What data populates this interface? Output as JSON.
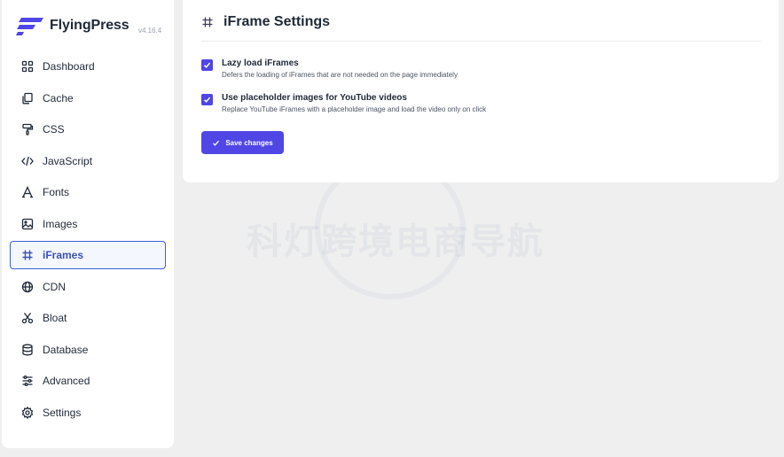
{
  "brand": {
    "name": "FlyingPress",
    "version": "v4.16.4"
  },
  "sidebar": {
    "items": [
      {
        "label": "Dashboard",
        "icon": "dashboard-icon"
      },
      {
        "label": "Cache",
        "icon": "copy-icon"
      },
      {
        "label": "CSS",
        "icon": "paint-roller-icon"
      },
      {
        "label": "JavaScript",
        "icon": "code-icon"
      },
      {
        "label": "Fonts",
        "icon": "font-icon"
      },
      {
        "label": "Images",
        "icon": "image-icon"
      },
      {
        "label": "iFrames",
        "icon": "hash-icon",
        "active": true
      },
      {
        "label": "CDN",
        "icon": "globe-icon"
      },
      {
        "label": "Bloat",
        "icon": "scissors-icon"
      },
      {
        "label": "Database",
        "icon": "database-icon"
      },
      {
        "label": "Advanced",
        "icon": "sliders-icon"
      },
      {
        "label": "Settings",
        "icon": "gear-icon"
      }
    ]
  },
  "panel": {
    "title": "iFrame Settings",
    "options": [
      {
        "title": "Lazy load iFrames",
        "description": "Defers the loading of iFrames that are not needed on the page immediately",
        "checked": true
      },
      {
        "title": "Use placeholder images for YouTube videos",
        "description": "Replace YouTube iFrames with a placeholder image and load the video only on click",
        "checked": true
      }
    ],
    "save_label": "Save changes"
  },
  "watermark": "科灯跨境电商导航",
  "colors": {
    "accent": "#4f46e5",
    "active_border": "#3b5fd9",
    "background": "#efefef"
  }
}
